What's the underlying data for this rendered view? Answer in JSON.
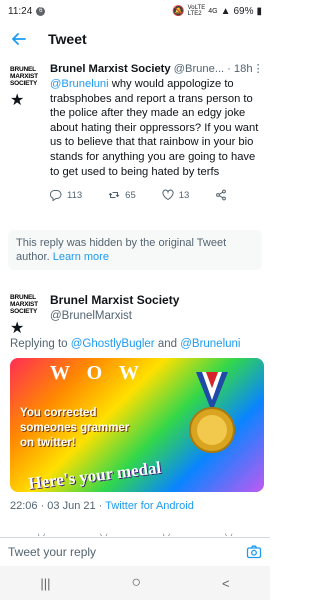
{
  "status_bar": {
    "time": "11:24",
    "notif_badge": "6",
    "signal_text_top": "VoLTE",
    "signal_text_mid": "LTE2",
    "signal_gen": "4G",
    "battery": "69%"
  },
  "app_bar": {
    "title": "Tweet"
  },
  "reply_tweet": {
    "author_name": "Brunel Marxist Society",
    "author_handle": "@Brune...",
    "separator": "·",
    "time": "18h",
    "mention": "@Bruneluni",
    "text": " why would appologize to trabsphobes and report a trans person to the police after they made an edgy joke about hating their oppressors? If you want us to believe that that rainbow in your bio stands for anything you are going to have to get used to being hated by terfs",
    "replies": "113",
    "retweets": "65",
    "likes": "13"
  },
  "hidden_notice": {
    "text": "This reply was hidden by the original Tweet author. ",
    "link": "Learn more"
  },
  "logo": {
    "line1": "BRUNEL",
    "line2": "MARXIST",
    "line3": "SOCIETY"
  },
  "focus_tweet": {
    "author_name": "Brunel Marxist Society",
    "author_handle": "@BrunelMarxist",
    "replying_prefix": "Replying to ",
    "replying_user1": "@GhostlyBugler",
    "replying_and": " and ",
    "replying_user2": "@Bruneluni",
    "image_text": {
      "wow": "W O W",
      "line1a": "You corrected",
      "line1b": "someones grammer",
      "line1c": "on twitter!",
      "line2": "Here's your medal"
    },
    "timestamp": "22:06 · 03 Jun 21 · ",
    "source": "Twitter for Android"
  },
  "composer": {
    "placeholder": "Tweet your reply"
  },
  "nav": {
    "recents": "|||",
    "home": "○",
    "back": "<"
  },
  "colors": {
    "accent": "#1d9bf0",
    "secondary_text": "#536471",
    "logo_star": "#d7263d"
  }
}
